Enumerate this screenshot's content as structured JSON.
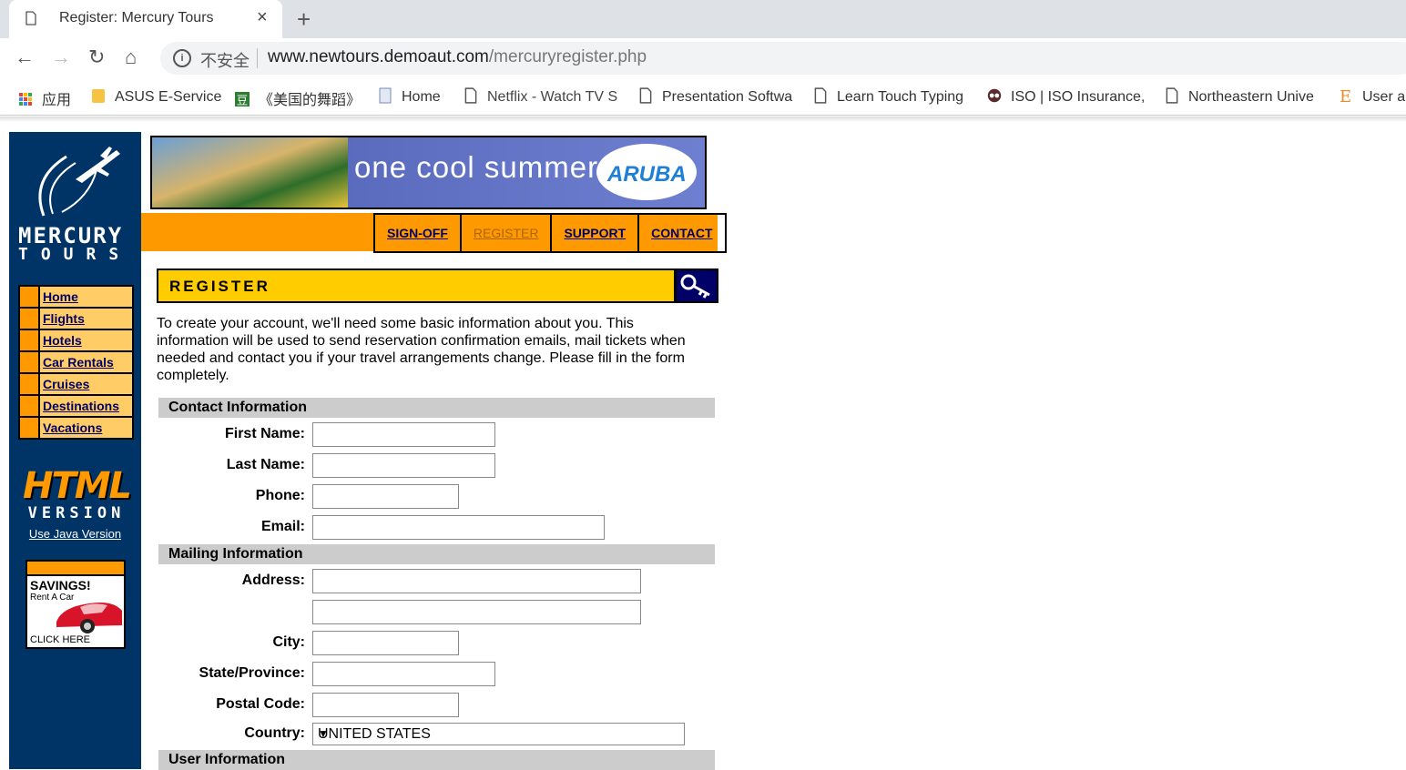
{
  "browser": {
    "tab_title": "Register: Mercury Tours",
    "close_glyph": "×",
    "newtab_glyph": "+",
    "insecure_label": "不安全",
    "url_host": "www.newtours.demoaut.com",
    "url_path": "/mercuryregister.php",
    "bookmarks": [
      {
        "label": "应用",
        "icon": "apps-grid-icon"
      },
      {
        "label": "ASUS E-Service",
        "icon": "folder-icon"
      },
      {
        "label": "《美国的舞蹈》",
        "icon": "douban-icon"
      },
      {
        "label": "Home",
        "icon": "page-icon"
      },
      {
        "label": "Netflix - Watch TV S",
        "icon": "page-icon"
      },
      {
        "label": "Presentation Softwa",
        "icon": "page-icon"
      },
      {
        "label": "Learn Touch Typing",
        "icon": "page-icon"
      },
      {
        "label": "ISO | ISO Insurance,",
        "icon": "owl-icon"
      },
      {
        "label": "Northeastern Unive",
        "icon": "page-icon"
      },
      {
        "label": "User a",
        "icon": "e-icon"
      }
    ]
  },
  "brand": {
    "line1": "MERCURY",
    "line2": "TOURS"
  },
  "sidenav": [
    "Home",
    "Flights",
    "Hotels",
    "Car Rentals",
    "Cruises",
    "Destinations",
    "Vacations"
  ],
  "html_version": {
    "line1": "HTML",
    "line2": "VERSION",
    "java_link": "Use Java Version"
  },
  "savings_ad": {
    "title": "SAVINGS!",
    "subtitle": "Rent A Car",
    "cta": "CLICK HERE"
  },
  "banner": {
    "text": "one cool summer",
    "badge": "ARUBA"
  },
  "topnav": [
    "SIGN-OFF",
    "REGISTER",
    "SUPPORT",
    "CONTACT"
  ],
  "page": {
    "heading": "REGISTER",
    "intro": "To create your account, we'll need some basic information about you. This information will be used to send reservation confirmation emails, mail tickets when needed and contact you if your travel arrangements change. Please fill in the form completely."
  },
  "form": {
    "contact_section": "Contact Information",
    "first_name": "First Name:",
    "last_name": "Last Name:",
    "phone": "Phone:",
    "email": "Email:",
    "mailing_section": "Mailing Information",
    "address": "Address:",
    "city": "City:",
    "state": "State/Province:",
    "postal": "Postal Code:",
    "country": "Country:",
    "country_value": "UNITED STATES",
    "user_section": "User Information"
  }
}
